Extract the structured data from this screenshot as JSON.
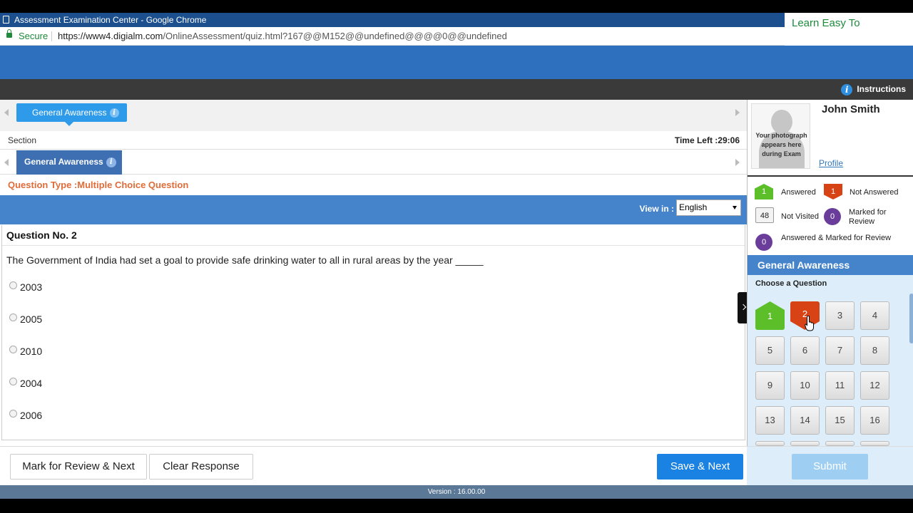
{
  "browser": {
    "title": "Assessment Examination Center - Google Chrome",
    "secure_label": "Secure",
    "url_host": "https://www4.digialm.com",
    "url_path": "/OnlineAssessment/quiz.html?167@@M152@@undefined@@@@0@@undefined"
  },
  "overlay_text": "Learn Easy To",
  "header": {
    "instructions_label": "Instructions"
  },
  "section_tabs": [
    {
      "label": "General Awareness",
      "active": true
    }
  ],
  "section_label": "Section",
  "time_left": "Time Left :29:06",
  "subsections": [
    {
      "label": "General Awareness",
      "active": true
    }
  ],
  "question_type": "Question Type :Multiple Choice Question",
  "view_in": {
    "label": "View in :",
    "selected_language": "English"
  },
  "question": {
    "number_label": "Question No. 2",
    "text": "The Government of India had set a goal to provide safe drinking water to all in rural areas by the year _____",
    "options": [
      "2003",
      "2005",
      "2010",
      "2004",
      "2006"
    ]
  },
  "candidate": {
    "name": "John Smith",
    "photo_placeholder": "Your photograph appears here during Exam",
    "profile_link": "Profile"
  },
  "legend": {
    "answered": {
      "count": "1",
      "label": "Answered"
    },
    "not_answered": {
      "count": "1",
      "label": "Not Answered"
    },
    "not_visited": {
      "count": "48",
      "label": "Not Visited"
    },
    "marked_for_review": {
      "count": "0",
      "label": "Marked for Review"
    },
    "answered_marked": {
      "count": "0",
      "label": "Answered & Marked for Review"
    }
  },
  "palette": {
    "section_title": "General Awareness",
    "choose_label": "Choose a Question",
    "questions": [
      {
        "num": "1",
        "status": "answered"
      },
      {
        "num": "2",
        "status": "not_answered"
      },
      {
        "num": "3",
        "status": "not_visited"
      },
      {
        "num": "4",
        "status": "not_visited"
      },
      {
        "num": "5",
        "status": "not_visited"
      },
      {
        "num": "6",
        "status": "not_visited"
      },
      {
        "num": "7",
        "status": "not_visited"
      },
      {
        "num": "8",
        "status": "not_visited"
      },
      {
        "num": "9",
        "status": "not_visited"
      },
      {
        "num": "10",
        "status": "not_visited"
      },
      {
        "num": "11",
        "status": "not_visited"
      },
      {
        "num": "12",
        "status": "not_visited"
      },
      {
        "num": "13",
        "status": "not_visited"
      },
      {
        "num": "14",
        "status": "not_visited"
      },
      {
        "num": "15",
        "status": "not_visited"
      },
      {
        "num": "16",
        "status": "not_visited"
      }
    ]
  },
  "actions": {
    "mark_review_next": "Mark for Review & Next",
    "clear_response": "Clear Response",
    "save_next": "Save & Next",
    "submit": "Submit"
  },
  "version": "Version : 16.00.00",
  "colors": {
    "header_blue": "#2e6fbe",
    "tab_blue": "#2e9bea",
    "answered_green": "#5cbf2a",
    "not_answered_red": "#d84315",
    "review_purple": "#6a3d9a",
    "primary_button": "#1a82e2"
  }
}
